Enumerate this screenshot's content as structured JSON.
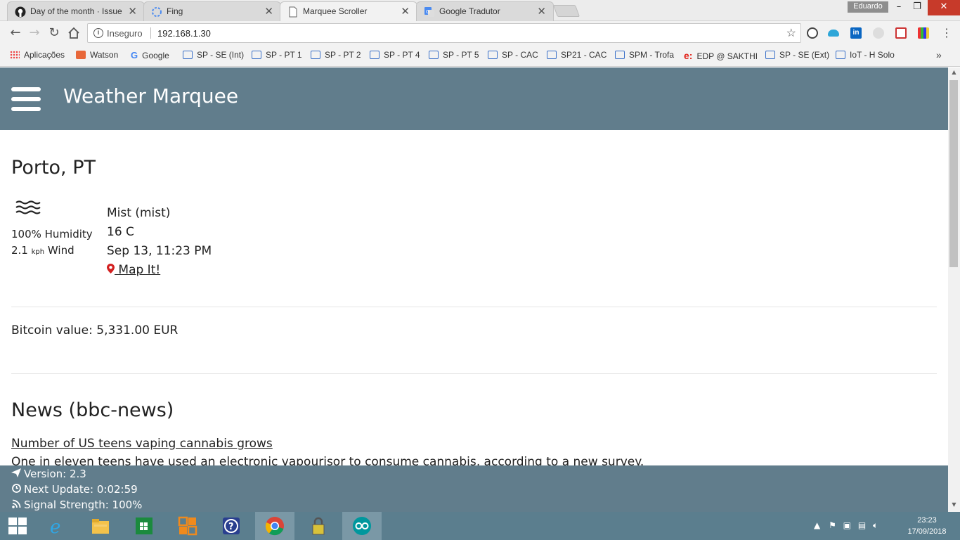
{
  "browser": {
    "tabs": [
      {
        "title": "Day of the month · Issue",
        "icon": "github-icon",
        "active": false
      },
      {
        "title": "Fing",
        "icon": "loading-icon",
        "active": false
      },
      {
        "title": "Marquee Scroller",
        "icon": "page-icon",
        "active": true
      },
      {
        "title": "Google Tradutor",
        "icon": "translate-icon",
        "active": false
      }
    ],
    "close_glyph": "✕",
    "profile_name": "Eduardo",
    "window_controls": {
      "minimize": "–",
      "maximize": "❐",
      "close": "✕"
    },
    "insecure_label": "Inseguro",
    "url": "192.168.1.30",
    "bookmarks": [
      {
        "label": "Aplicações",
        "icon": "apps-grid-icon"
      },
      {
        "label": "Watson",
        "icon": "watson-icon"
      },
      {
        "label": "Google",
        "icon": "google-icon"
      },
      {
        "label": "SP - SE (Int)",
        "icon": "chat-icon"
      },
      {
        "label": "SP - PT 1",
        "icon": "chat-icon"
      },
      {
        "label": "SP - PT 2",
        "icon": "chat-icon"
      },
      {
        "label": "SP - PT 4",
        "icon": "chat-icon"
      },
      {
        "label": "SP - PT 5",
        "icon": "chat-icon"
      },
      {
        "label": "SP - CAC",
        "icon": "chat-icon"
      },
      {
        "label": "SP21 - CAC",
        "icon": "chat-icon"
      },
      {
        "label": "SPM - Trofa",
        "icon": "chat-icon"
      },
      {
        "label": "EDP @ SAKTHI",
        "icon": "edp-icon"
      },
      {
        "label": "SP - SE (Ext)",
        "icon": "chat-icon"
      },
      {
        "label": "IoT - H Solo",
        "icon": "chat-icon"
      }
    ],
    "more_glyph": "»"
  },
  "app": {
    "title": "Weather Marquee",
    "weather": {
      "city": "Porto, PT",
      "humidity": "100% Humidity",
      "wind_value": "2.1",
      "wind_unit": "kph",
      "wind_label": "Wind",
      "condition": "Mist (mist)",
      "temperature": "16 C",
      "datetime": "Sep 13, 11:23 PM",
      "map_link": " Map It!"
    },
    "bitcoin": "Bitcoin value: 5,331.00 EUR",
    "news": {
      "heading": "News (bbc-news)",
      "headline": "Number of US teens vaping cannabis grows",
      "summary": "One in eleven teens have used an electronic vapourisor to consume cannabis, according to a new survey."
    },
    "status": {
      "version": "Version: 2.3",
      "next_update": "Next Update: 0:02:59",
      "signal": "Signal Strength: 100%"
    }
  },
  "taskbar": {
    "apps": [
      "windows-start",
      "internet-explorer",
      "file-explorer",
      "store",
      "office",
      "help",
      "chrome",
      "keepass",
      "arduino"
    ],
    "clock_time": "23:23",
    "clock_date": "17/09/2018"
  },
  "colors": {
    "header_bg": "#617d8c",
    "taskbar_bg": "#5b7e8e",
    "pin_red": "#d32020"
  }
}
